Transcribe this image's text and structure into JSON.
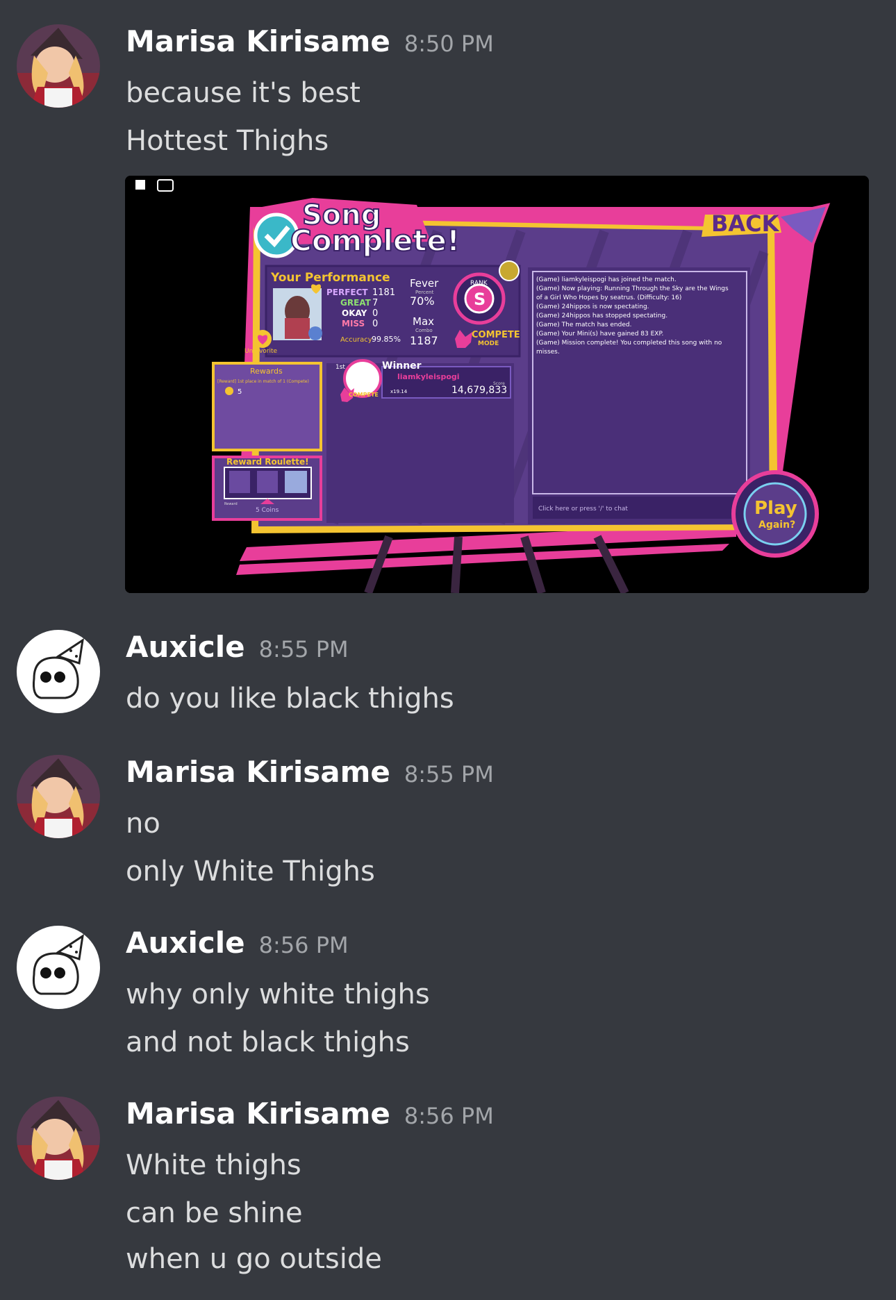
{
  "messages": [
    {
      "author": "Marisa Kirisame",
      "time": "8:50 PM",
      "lines": [
        "because it's best",
        "Hottest Thighs"
      ]
    },
    {
      "author": "Auxicle",
      "time": "8:55 PM",
      "lines": [
        "do you like black thighs"
      ]
    },
    {
      "author": "Marisa Kirisame",
      "time": "8:55 PM",
      "lines": [
        "no",
        "only White Thighs"
      ]
    },
    {
      "author": "Auxicle",
      "time": "8:56 PM",
      "lines": [
        "why only white thighs",
        "and not black thighs"
      ]
    },
    {
      "author": "Marisa Kirisame",
      "time": "8:56 PM",
      "lines": [
        "White thighs",
        "can be shine",
        "when u go outside"
      ]
    }
  ],
  "game": {
    "title_line1": "Song",
    "title_line2": "Complete!",
    "back": "BACK",
    "your_performance": "Your Performance",
    "perfect_label": "PERFECT",
    "perfect_value": "1181",
    "great_label": "GREAT",
    "great_value": "7",
    "okay_label": "OKAY",
    "okay_value": "0",
    "miss_label": "MISS",
    "miss_value": "0",
    "accuracy_label": "Accuracy",
    "accuracy_value": "99.85%",
    "fever_label": "Fever",
    "fever_sub": "Percent",
    "fever_value": "70%",
    "max_label": "Max",
    "max_sub": "Combo",
    "max_value": "1187",
    "rank_label": "RANK",
    "rank_value": "S",
    "compete": "COMPETE",
    "mode": "MODE",
    "unfavorite": "Unfavorite",
    "rewards": "Rewards",
    "reward_line": "[Reward] 1st place in match of 1 (Compete)",
    "reward_coins": "5",
    "roulette": "Reward Roulette!",
    "roulette_reward": "Reward",
    "roulette_coins": "5 Coins",
    "first": "1st",
    "winner": "Winner",
    "winner_name": "liamkyleispogi",
    "score_label": "Score",
    "score_value": "14,679,833",
    "multiplier": "x19.14",
    "chat": [
      "(Game) liamkyleispogi has joined the match.",
      "(Game) Now playing: Running Through the Sky are the Wings",
      "of a Girl Who Hopes by seatrus. (Difficulty: 16)",
      "(Game) 24hippos is now spectating.",
      "(Game) 24hippos has stopped spectating.",
      "(Game) The match has ended.",
      "(Game) Your Mini(s) have gained 83 EXP.",
      "(Game) Mission complete! You completed this song with no",
      "misses."
    ],
    "chat_hint": "Click here or press '/' to chat",
    "play": "Play",
    "again": "Again?"
  }
}
